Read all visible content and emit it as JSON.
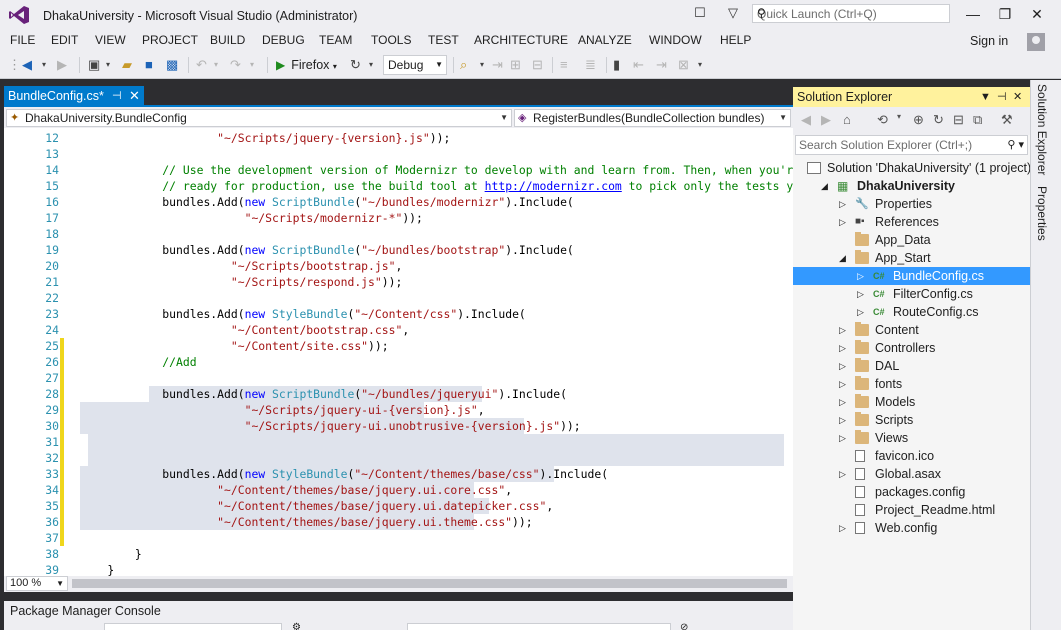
{
  "window": {
    "title": "DhakaUniversity - Microsoft Visual Studio (Administrator)",
    "quick_launch_placeholder": "Quick Launch (Ctrl+Q)",
    "minimize": "—",
    "restore": "❐",
    "close": "✕"
  },
  "menu": [
    "FILE",
    "EDIT",
    "VIEW",
    "PROJECT",
    "BUILD",
    "DEBUG",
    "TEAM",
    "TOOLS",
    "TEST",
    "ARCHITECTURE",
    "ANALYZE",
    "WINDOW",
    "HELP"
  ],
  "signin": "Sign in",
  "toolbar": {
    "run_target": "Firefox",
    "configuration": "Debug"
  },
  "editor": {
    "tab_label": "BundleConfig.cs*",
    "tab_pin": "⊣",
    "tab_close": "✕",
    "nav_class": "DhakaUniversity.BundleConfig",
    "nav_member": "RegisterBundles(BundleCollection bundles)",
    "zoom": "100 %",
    "lines": [
      {
        "n": "12",
        "code": "                    \"~/Scripts/jquery-{version}.js\"));"
      },
      {
        "n": "13",
        "code": ""
      },
      {
        "n": "14",
        "code": "            // Use the development version of Modernizr to develop with and learn from. Then, when you're"
      },
      {
        "n": "15",
        "code": "            // ready for production, use the build tool at http://modernizr.com to pick only the tests you need."
      },
      {
        "n": "16",
        "code": "            bundles.Add(new ScriptBundle(\"~/bundles/modernizr\").Include("
      },
      {
        "n": "17",
        "code": "                        \"~/Scripts/modernizr-*\"));"
      },
      {
        "n": "18",
        "code": ""
      },
      {
        "n": "19",
        "code": "            bundles.Add(new ScriptBundle(\"~/bundles/bootstrap\").Include("
      },
      {
        "n": "20",
        "code": "                      \"~/Scripts/bootstrap.js\","
      },
      {
        "n": "21",
        "code": "                      \"~/Scripts/respond.js\"));"
      },
      {
        "n": "22",
        "code": ""
      },
      {
        "n": "23",
        "code": "            bundles.Add(new StyleBundle(\"~/Content/css\").Include("
      },
      {
        "n": "24",
        "code": "                      \"~/Content/bootstrap.css\","
      },
      {
        "n": "25",
        "code": "                      \"~/Content/site.css\"));"
      },
      {
        "n": "26",
        "code": "            //Add"
      },
      {
        "n": "27",
        "code": ""
      },
      {
        "n": "28",
        "code": "            bundles.Add(new ScriptBundle(\"~/bundles/jqueryui\").Include("
      },
      {
        "n": "29",
        "code": "                        \"~/Scripts/jquery-ui-{version}.js\","
      },
      {
        "n": "30",
        "code": "                        \"~/Scripts/jquery-ui.unobtrusive-{version}.js\"));"
      },
      {
        "n": "31",
        "code": ""
      },
      {
        "n": "32",
        "code": ""
      },
      {
        "n": "33",
        "code": "            bundles.Add(new StyleBundle(\"~/Content/themes/base/css\").Include("
      },
      {
        "n": "34",
        "code": "                    \"~/Content/themes/base/jquery.ui.core.css\","
      },
      {
        "n": "35",
        "code": "                    \"~/Content/themes/base/jquery.ui.datepicker.css\","
      },
      {
        "n": "36",
        "code": "                    \"~/Content/themes/base/jquery.ui.theme.css\"));"
      },
      {
        "n": "37",
        "code": ""
      },
      {
        "n": "38",
        "code": "        }"
      },
      {
        "n": "39",
        "code": "    }"
      }
    ]
  },
  "console": {
    "title": "Package Manager Console"
  },
  "solution_explorer": {
    "title": "Solution Explorer",
    "search_placeholder": "Search Solution Explorer (Ctrl+;)",
    "nodes": [
      {
        "label": "Solution 'DhakaUniversity' (1 project)",
        "depth": 0,
        "exp": "",
        "icon": "sln"
      },
      {
        "label": "DhakaUniversity",
        "depth": 1,
        "exp": "◢",
        "icon": "proj",
        "bold": true
      },
      {
        "label": "Properties",
        "depth": 2,
        "exp": "▷",
        "icon": "wrench"
      },
      {
        "label": "References",
        "depth": 2,
        "exp": "▷",
        "icon": "refs"
      },
      {
        "label": "App_Data",
        "depth": 2,
        "exp": "",
        "icon": "folder"
      },
      {
        "label": "App_Start",
        "depth": 2,
        "exp": "◢",
        "icon": "folder"
      },
      {
        "label": "BundleConfig.cs",
        "depth": 3,
        "exp": "▷",
        "icon": "cs",
        "selected": true
      },
      {
        "label": "FilterConfig.cs",
        "depth": 3,
        "exp": "▷",
        "icon": "cs"
      },
      {
        "label": "RouteConfig.cs",
        "depth": 3,
        "exp": "▷",
        "icon": "cs"
      },
      {
        "label": "Content",
        "depth": 2,
        "exp": "▷",
        "icon": "folder"
      },
      {
        "label": "Controllers",
        "depth": 2,
        "exp": "▷",
        "icon": "folder"
      },
      {
        "label": "DAL",
        "depth": 2,
        "exp": "▷",
        "icon": "folder"
      },
      {
        "label": "fonts",
        "depth": 2,
        "exp": "▷",
        "icon": "folder"
      },
      {
        "label": "Models",
        "depth": 2,
        "exp": "▷",
        "icon": "folder"
      },
      {
        "label": "Scripts",
        "depth": 2,
        "exp": "▷",
        "icon": "folder"
      },
      {
        "label": "Views",
        "depth": 2,
        "exp": "▷",
        "icon": "folder"
      },
      {
        "label": "favicon.ico",
        "depth": 2,
        "exp": "",
        "icon": "file"
      },
      {
        "label": "Global.asax",
        "depth": 2,
        "exp": "▷",
        "icon": "file"
      },
      {
        "label": "packages.config",
        "depth": 2,
        "exp": "",
        "icon": "file"
      },
      {
        "label": "Project_Readme.html",
        "depth": 2,
        "exp": "",
        "icon": "file"
      },
      {
        "label": "Web.config",
        "depth": 2,
        "exp": "▷",
        "icon": "file"
      }
    ]
  },
  "side_tabs": [
    "Solution Explorer",
    "Properties"
  ],
  "colors": {
    "accent": "#007acc",
    "selection": "#3399ff",
    "panel_header": "#fff29d",
    "change_marker": "#efd61c"
  }
}
